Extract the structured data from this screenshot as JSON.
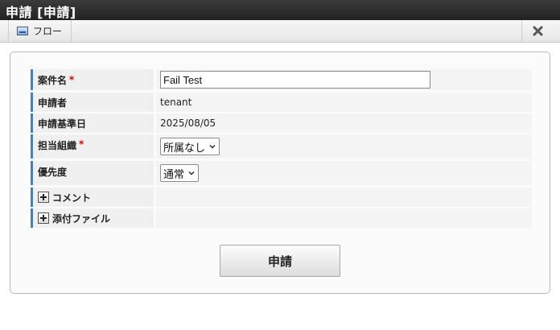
{
  "window": {
    "title": "申請 [申請]"
  },
  "toolbar": {
    "flow_tab_label": "フロー",
    "flow_icon": "flow-image-icon",
    "close_icon": "close-x-icon"
  },
  "form": {
    "rows": [
      {
        "label": "案件名",
        "required": "*",
        "value": "Fail Test",
        "type": "text-input"
      },
      {
        "label": "申請者",
        "value": "tenant",
        "type": "text"
      },
      {
        "label": "申請基準日",
        "value": "2025/08/05",
        "type": "text"
      },
      {
        "label": "担当組織",
        "required": "*",
        "value": "所属なし",
        "type": "select"
      },
      {
        "label": "優先度",
        "value": "通常",
        "type": "select"
      },
      {
        "label": "コメント",
        "type": "expander"
      },
      {
        "label": "添付ファイル",
        "type": "expander"
      }
    ]
  },
  "submit": {
    "label": "申請"
  },
  "colors": {
    "titlebar": "#2b2b2b",
    "label_accent": "#4a7fb5",
    "required": "#dd0000"
  }
}
